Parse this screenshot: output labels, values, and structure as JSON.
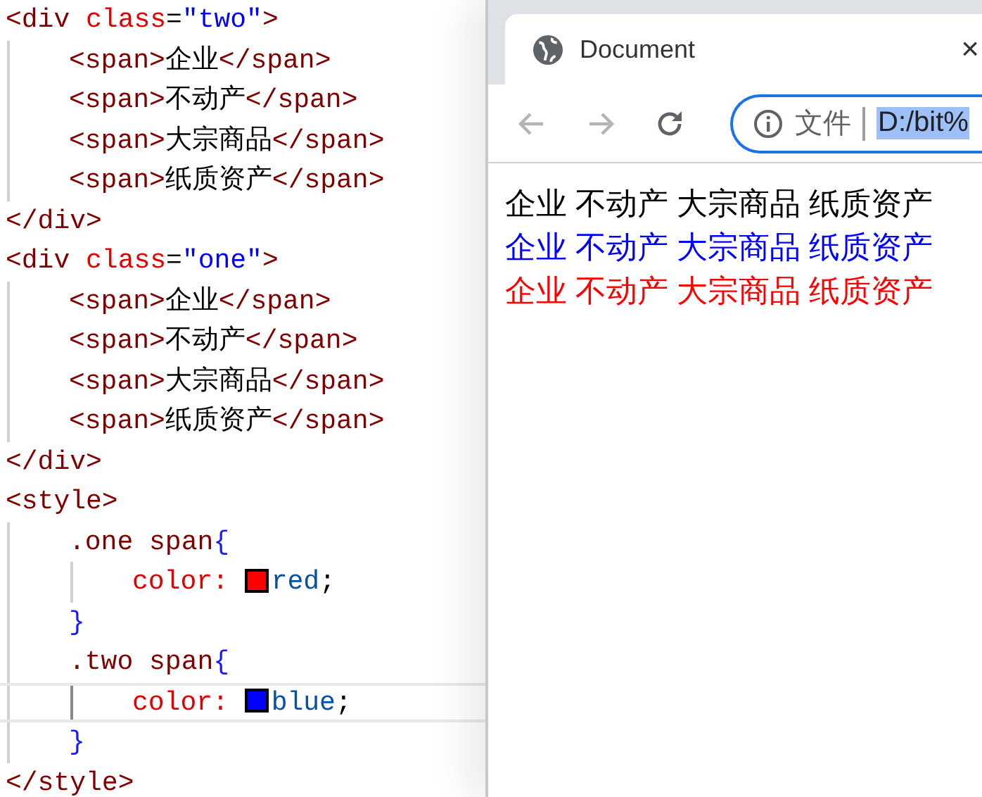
{
  "editor": {
    "lines": [
      {
        "highlighted": false,
        "tokens": [
          {
            "kind": "tag",
            "text": "<div "
          },
          {
            "kind": "attr",
            "text": "class"
          },
          {
            "kind": "punct",
            "text": "="
          },
          {
            "kind": "string",
            "text": "\"two\""
          },
          {
            "kind": "tag",
            "text": ">"
          }
        ],
        "children": [
          {
            "highlighted": false,
            "tokens": [
              {
                "kind": "tag",
                "text": "<span>"
              },
              {
                "kind": "text",
                "text": "企业"
              },
              {
                "kind": "tag",
                "text": "</span>"
              }
            ]
          },
          {
            "highlighted": false,
            "tokens": [
              {
                "kind": "tag",
                "text": "<span>"
              },
              {
                "kind": "text",
                "text": "不动产"
              },
              {
                "kind": "tag",
                "text": "</span>"
              }
            ]
          },
          {
            "highlighted": false,
            "tokens": [
              {
                "kind": "tag",
                "text": "<span>"
              },
              {
                "kind": "text",
                "text": "大宗商品"
              },
              {
                "kind": "tag",
                "text": "</span>"
              }
            ]
          },
          {
            "highlighted": false,
            "tokens": [
              {
                "kind": "tag",
                "text": "<span>"
              },
              {
                "kind": "text",
                "text": "纸质资产"
              },
              {
                "kind": "tag",
                "text": "</span>"
              }
            ]
          }
        ]
      },
      {
        "highlighted": false,
        "tokens": [
          {
            "kind": "tag",
            "text": "</div>"
          }
        ]
      },
      {
        "highlighted": false,
        "tokens": [
          {
            "kind": "tag",
            "text": "<div "
          },
          {
            "kind": "attr",
            "text": "class"
          },
          {
            "kind": "punct",
            "text": "="
          },
          {
            "kind": "string",
            "text": "\"one\""
          },
          {
            "kind": "tag",
            "text": ">"
          }
        ],
        "children": [
          {
            "highlighted": false,
            "tokens": [
              {
                "kind": "tag",
                "text": "<span>"
              },
              {
                "kind": "text",
                "text": "企业"
              },
              {
                "kind": "tag",
                "text": "</span>"
              }
            ]
          },
          {
            "highlighted": false,
            "tokens": [
              {
                "kind": "tag",
                "text": "<span>"
              },
              {
                "kind": "text",
                "text": "不动产"
              },
              {
                "kind": "tag",
                "text": "</span>"
              }
            ]
          },
          {
            "highlighted": false,
            "tokens": [
              {
                "kind": "tag",
                "text": "<span>"
              },
              {
                "kind": "text",
                "text": "大宗商品"
              },
              {
                "kind": "tag",
                "text": "</span>"
              }
            ]
          },
          {
            "highlighted": false,
            "tokens": [
              {
                "kind": "tag",
                "text": "<span>"
              },
              {
                "kind": "text",
                "text": "纸质资产"
              },
              {
                "kind": "tag",
                "text": "</span>"
              }
            ]
          }
        ]
      },
      {
        "highlighted": false,
        "tokens": [
          {
            "kind": "tag",
            "text": "</div>"
          }
        ]
      },
      {
        "highlighted": false,
        "tokens": [
          {
            "kind": "tag",
            "text": "<style>"
          }
        ],
        "children": [
          {
            "highlighted": false,
            "tokens": [
              {
                "kind": "selector",
                "text": ".one span"
              },
              {
                "kind": "brace",
                "text": "{"
              }
            ],
            "children": [
              {
                "highlighted": false,
                "tokens": [
                  {
                    "kind": "prop",
                    "text": "color: "
                  },
                  {
                    "kind": "swatch",
                    "color": "#ff0000"
                  },
                  {
                    "kind": "value",
                    "text": "red"
                  },
                  {
                    "kind": "punct",
                    "text": ";"
                  }
                ]
              }
            ]
          },
          {
            "highlighted": false,
            "tokens": [
              {
                "kind": "brace",
                "text": "}"
              }
            ]
          },
          {
            "highlighted": false,
            "tokens": [
              {
                "kind": "selector",
                "text": ".two span"
              },
              {
                "kind": "brace",
                "text": "{"
              }
            ],
            "children": [
              {
                "highlighted": true,
                "tokens": [
                  {
                    "kind": "prop",
                    "text": "color: "
                  },
                  {
                    "kind": "swatch",
                    "color": "#0000ff"
                  },
                  {
                    "kind": "value",
                    "text": "blue"
                  },
                  {
                    "kind": "punct",
                    "text": ";"
                  }
                ]
              }
            ]
          },
          {
            "highlighted": false,
            "tokens": [
              {
                "kind": "brace",
                "text": "}"
              }
            ]
          }
        ]
      },
      {
        "highlighted": false,
        "tokens": [
          {
            "kind": "tag",
            "text": "</style>"
          }
        ]
      }
    ]
  },
  "browser": {
    "tab": {
      "title": "Document",
      "close": "×",
      "selected": true
    },
    "nav_buttons": [
      {
        "kind": "back",
        "disabled": true
      },
      {
        "kind": "forward",
        "disabled": true
      },
      {
        "kind": "reload",
        "disabled": false
      }
    ],
    "address": {
      "label": "文件",
      "value": "D:/bit%",
      "focused": true,
      "selected": true
    },
    "page_content": [
      {
        "color": "#000000",
        "spans": [
          "企业",
          "不动产",
          "大宗商品",
          "纸质资产"
        ]
      },
      {
        "color": "#0000ff",
        "spans": [
          "企业",
          "不动产",
          "大宗商品",
          "纸质资产"
        ]
      },
      {
        "color": "#ff0000",
        "spans": [
          "企业",
          "不动产",
          "大宗商品",
          "纸质资产"
        ]
      }
    ]
  }
}
